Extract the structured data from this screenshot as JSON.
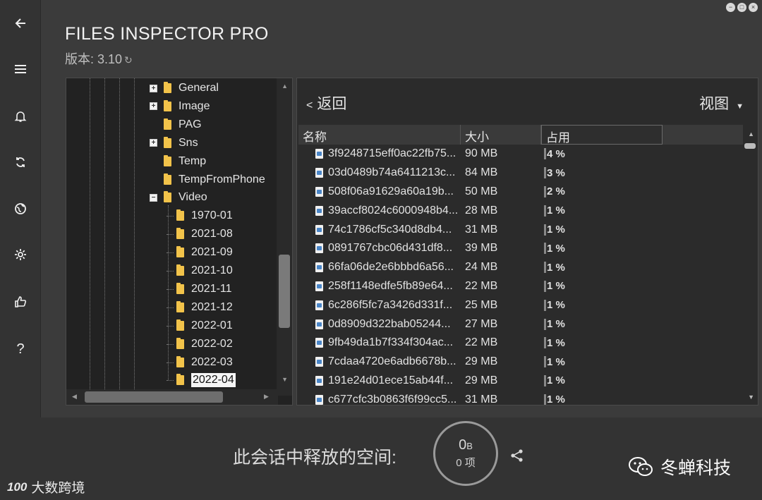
{
  "app": {
    "title": "FILES INSPECTOR PRO",
    "version": "版本: 3.10"
  },
  "rail": [
    {
      "icon": "back-arrow-icon"
    },
    {
      "icon": "menu-icon"
    },
    {
      "icon": "bell-icon"
    },
    {
      "icon": "sync-icon"
    },
    {
      "icon": "globe-icon"
    },
    {
      "icon": "gear-icon"
    },
    {
      "icon": "thumbs-up-icon"
    },
    {
      "icon": "help-icon",
      "glyph": "?"
    }
  ],
  "tree": {
    "nodes": [
      {
        "label": "General",
        "expander": "+",
        "level": 0
      },
      {
        "label": "Image",
        "expander": "+",
        "level": 0
      },
      {
        "label": "PAG",
        "expander": "",
        "level": 0
      },
      {
        "label": "Sns",
        "expander": "+",
        "level": 0
      },
      {
        "label": "Temp",
        "expander": "",
        "level": 0
      },
      {
        "label": "TempFromPhone",
        "expander": "",
        "level": 0
      },
      {
        "label": "Video",
        "expander": "−",
        "level": 0
      },
      {
        "label": "1970-01",
        "expander": "",
        "level": 1
      },
      {
        "label": "2021-08",
        "expander": "",
        "level": 1
      },
      {
        "label": "2021-09",
        "expander": "",
        "level": 1
      },
      {
        "label": "2021-10",
        "expander": "",
        "level": 1
      },
      {
        "label": "2021-11",
        "expander": "",
        "level": 1
      },
      {
        "label": "2021-12",
        "expander": "",
        "level": 1
      },
      {
        "label": "2022-01",
        "expander": "",
        "level": 1
      },
      {
        "label": "2022-02",
        "expander": "",
        "level": 1
      },
      {
        "label": "2022-03",
        "expander": "",
        "level": 1
      },
      {
        "label": "2022-04",
        "expander": "",
        "level": 1,
        "selected": true
      }
    ]
  },
  "files": {
    "back_label": "返回",
    "back_glyph": "<",
    "view_label": "视图",
    "columns": [
      "名称",
      "大小",
      "占用"
    ],
    "rows": [
      {
        "name": "3f9248715eff0ac22fb75...",
        "size": "90 MB",
        "pct": "4 %"
      },
      {
        "name": "03d0489b74a6411213c...",
        "size": "84 MB",
        "pct": "3 %"
      },
      {
        "name": "508f06a91629a60a19b...",
        "size": "50 MB",
        "pct": "2 %"
      },
      {
        "name": "39accf8024c6000948b4...",
        "size": "28 MB",
        "pct": "1 %"
      },
      {
        "name": "74c1786cf5c340d8db4...",
        "size": "31 MB",
        "pct": "1 %"
      },
      {
        "name": "0891767cbc06d431df8...",
        "size": "39 MB",
        "pct": "1 %"
      },
      {
        "name": "66fa06de2e6bbbd6a56...",
        "size": "24 MB",
        "pct": "1 %"
      },
      {
        "name": "258f1148edfe5fb89e64...",
        "size": "22 MB",
        "pct": "1 %"
      },
      {
        "name": "6c286f5fc7a3426d331f...",
        "size": "25 MB",
        "pct": "1 %"
      },
      {
        "name": "0d8909d322bab05244...",
        "size": "27 MB",
        "pct": "1 %"
      },
      {
        "name": "9fb49da1b7f334f304ac...",
        "size": "22 MB",
        "pct": "1 %"
      },
      {
        "name": "7cdaa4720e6adb6678b...",
        "size": "29 MB",
        "pct": "1 %"
      },
      {
        "name": "191e24d01ece15ab44f...",
        "size": "29 MB",
        "pct": "1 %"
      },
      {
        "name": "c677cfc3b0863f6f99cc5...",
        "size": "31 MB",
        "pct": "1 %"
      }
    ]
  },
  "session": {
    "label": "此会话中释放的空间:",
    "freed_value": "0",
    "freed_unit": "B",
    "items": "0 项"
  },
  "watermarks": {
    "wechat": "冬蝉科技",
    "corner": "大数跨境",
    "corner_logo": "100"
  }
}
